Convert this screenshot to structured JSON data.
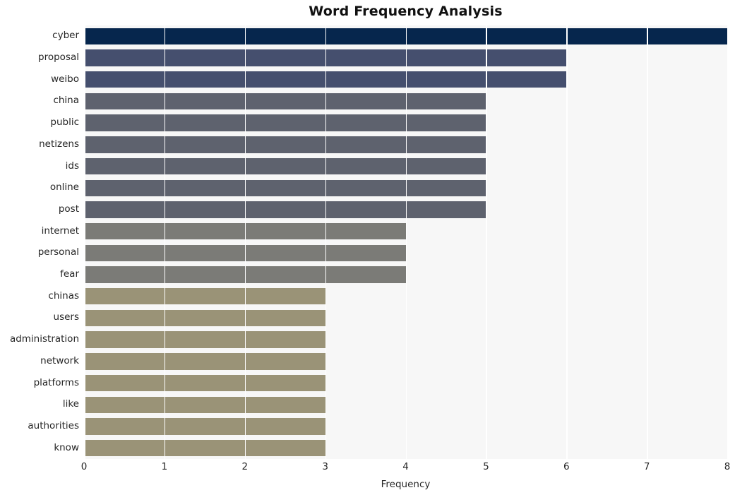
{
  "chart_data": {
    "type": "bar",
    "orientation": "horizontal",
    "title": "Word Frequency Analysis",
    "xlabel": "Frequency",
    "ylabel": "",
    "xlim": [
      0,
      8
    ],
    "ylim": [
      0,
      20
    ],
    "grid": "vertical-white-gridlines",
    "legend": "none",
    "categories": [
      "cyber",
      "proposal",
      "weibo",
      "china",
      "public",
      "netizens",
      "ids",
      "online",
      "post",
      "internet",
      "personal",
      "fear",
      "chinas",
      "users",
      "administration",
      "network",
      "platforms",
      "like",
      "authorities",
      "know"
    ],
    "values": [
      8,
      6,
      6,
      5,
      5,
      5,
      5,
      5,
      5,
      4,
      4,
      4,
      3,
      3,
      3,
      3,
      3,
      3,
      3,
      3
    ],
    "bar_colors": [
      "#06264d",
      "#454f6e",
      "#454f6e",
      "#5e626e",
      "#5e626e",
      "#5e626e",
      "#5e626e",
      "#5e626e",
      "#5e626e",
      "#7b7b77",
      "#7b7b77",
      "#7b7b77",
      "#9a9377",
      "#9a9377",
      "#9a9377",
      "#9a9377",
      "#9a9377",
      "#9a9377",
      "#9a9377",
      "#9a9377"
    ],
    "xticks": [
      "0",
      "1",
      "2",
      "3",
      "4",
      "5",
      "6",
      "7",
      "8"
    ],
    "xtick_values": [
      0,
      1,
      2,
      3,
      4,
      5,
      6,
      7,
      8
    ],
    "plot_background": "#f7f7f7",
    "figure_background": "#ffffff",
    "gridline_color": "#ffffff",
    "tick_label_color": "#262626",
    "title_color": "#111111"
  }
}
